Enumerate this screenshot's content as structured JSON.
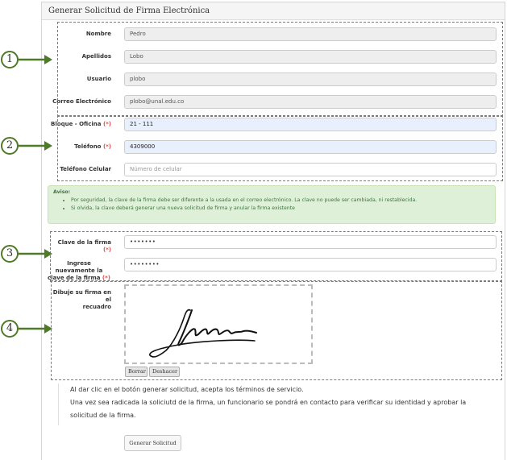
{
  "panel": {
    "title": "Generar Solicitud de Firma Electrónica"
  },
  "fields": {
    "nombre": {
      "label": "Nombre",
      "value": "Pedro"
    },
    "apellidos": {
      "label": "Apellidos",
      "value": "Lobo"
    },
    "usuario": {
      "label": "Usuario",
      "value": "plobo"
    },
    "correo": {
      "label": "Correo Electrónico",
      "value": "plobo@unal.edu.co"
    },
    "bloque": {
      "label": "Bloque - Oficina",
      "required_mark": "(*)",
      "value": "21 - 111"
    },
    "telefono": {
      "label": "Teléfono",
      "required_mark": "(*)",
      "value": "4309000"
    },
    "celular": {
      "label": "Teléfono Celular",
      "placeholder": "Número de celular"
    },
    "clave": {
      "label": "Clave de la firma",
      "required_mark": "(*)",
      "value": "•••••••"
    },
    "clave2": {
      "label_line1": "Ingrese nuevamente la",
      "label_line2": "clave de la firma",
      "required_mark": "(*)",
      "value": "••••••••"
    },
    "firma": {
      "label_line1": "Dibuje su firma en el",
      "label_line2": "recuadro"
    }
  },
  "alert": {
    "title": "Aviso:",
    "items": [
      "Por seguridad, la clave de la firma debe ser diferente a la usada en el correo electrónico. La clave no puede ser cambiada, ni restablecida.",
      "Si olvida, la clave deberá generar una nueva solicitud de firma y anular la firma existente"
    ]
  },
  "buttons": {
    "borrar": "Borrar",
    "deshacer": "Deshacer",
    "submit": "Generar Solicitud"
  },
  "terms": {
    "line1": "Al dar clic en el botón generar solicitud, acepta los términos de servicio.",
    "line2": "Una vez sea radicada la soliciutd de la firma, un funcionario se pondrá en contacto para verificar su identidad y aprobar la",
    "line3": "solicitud de la firma."
  },
  "callouts": [
    "1",
    "2",
    "3",
    "4"
  ],
  "colors": {
    "callout_green": "#4f7a28",
    "required_red": "#d9534f",
    "alert_bg": "#dff0d8",
    "autofill_blue": "#e8f0fe"
  }
}
